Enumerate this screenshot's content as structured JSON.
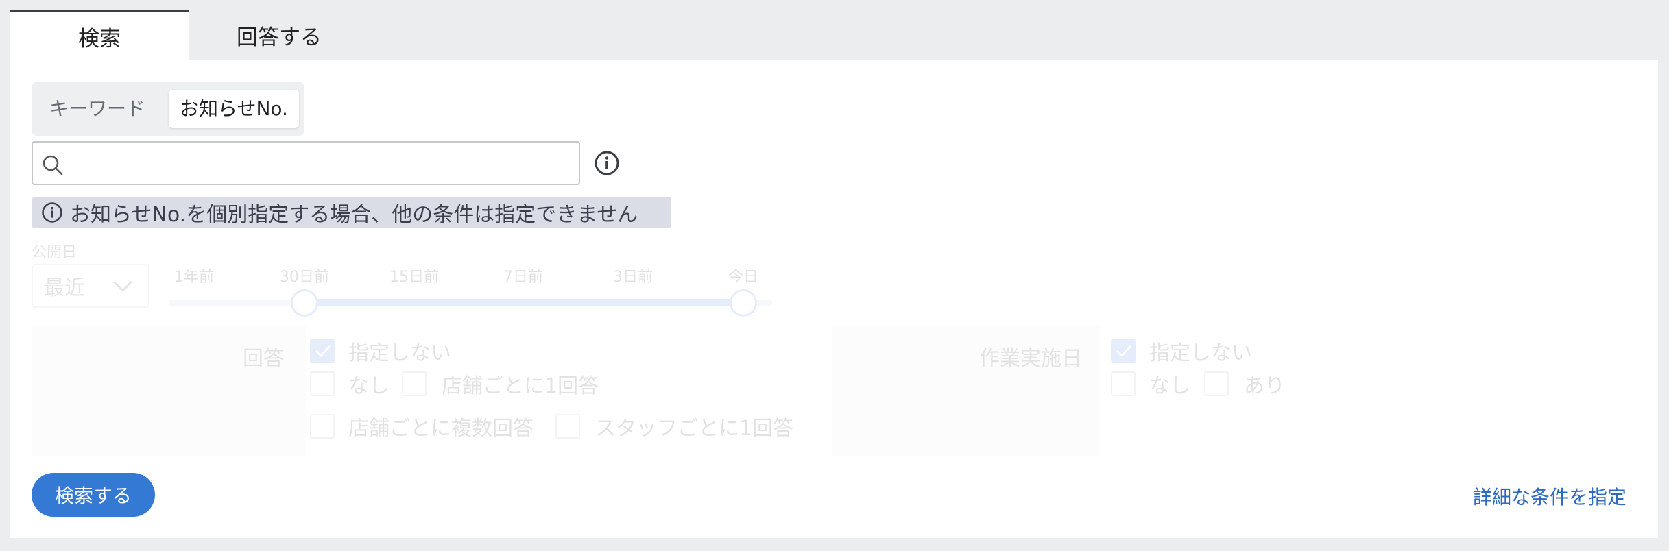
{
  "tabs": [
    {
      "label": "検索",
      "active": true
    },
    {
      "label": "回答する",
      "active": false
    }
  ],
  "search_mode": {
    "options": [
      "キーワード",
      "お知らせNo."
    ],
    "selected": "お知らせNo."
  },
  "search_input": {
    "value": "",
    "placeholder": ""
  },
  "notice": {
    "text": "お知らせNo.を個別指定する場合、他の条件は指定できません"
  },
  "publish_date": {
    "label": "公開日",
    "range_select": "最近",
    "ticks": [
      "1年前",
      "30日前",
      "15日前",
      "7日前",
      "3日前",
      "今日"
    ],
    "selected_range": [
      "30日前",
      "今日"
    ],
    "enabled": false
  },
  "answer_filter": {
    "label": "回答",
    "options": [
      {
        "label": "指定しない",
        "checked": true
      },
      {
        "label": "なし",
        "checked": false
      },
      {
        "label": "店舗ごとに1回答",
        "checked": false
      },
      {
        "label": "店舗ごとに複数回答",
        "checked": false
      },
      {
        "label": "スタッフごとに1回答",
        "checked": false
      }
    ]
  },
  "work_date_filter": {
    "label": "作業実施日",
    "options": [
      {
        "label": "指定しない",
        "checked": true
      },
      {
        "label": "なし",
        "checked": false
      },
      {
        "label": "あり",
        "checked": false
      }
    ]
  },
  "actions": {
    "search_button": "検索する",
    "detail_link": "詳細な条件を指定"
  },
  "colors": {
    "accent": "#3479d4",
    "link": "#2f6bbd",
    "notice_bg": "#dadde5",
    "page_bg": "#ecedef"
  }
}
